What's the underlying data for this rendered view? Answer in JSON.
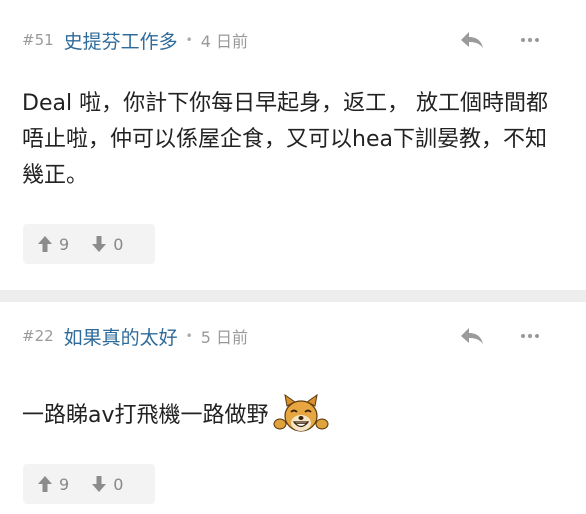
{
  "posts": [
    {
      "number": "#51",
      "username": "史提芬工作多",
      "separator": "•",
      "time": "4 日前",
      "content": "Deal 啦，你計下你每日早起身，返工， 放工個時間都唔止啦，仲可以係屋企食，又可以hea下訓晏教，不知幾正。",
      "upvotes": "9",
      "downvotes": "0"
    },
    {
      "number": "#22",
      "username": "如果真的太好",
      "separator": "•",
      "time": "5 日前",
      "content": "一路睇av打飛機一路做野",
      "upvotes": "9",
      "downvotes": "0",
      "emoji_icon": "dog-face-emoji-icon"
    }
  ],
  "icons": {
    "reply": "reply-arrow-icon",
    "more": "more-dots-icon",
    "up": "arrow-up-icon",
    "down": "arrow-down-icon"
  },
  "colors": {
    "username": "#2f6b9a",
    "meta": "#9a9a9a",
    "separator_band": "#ededed",
    "vote_bg": "#f3f3f3"
  }
}
